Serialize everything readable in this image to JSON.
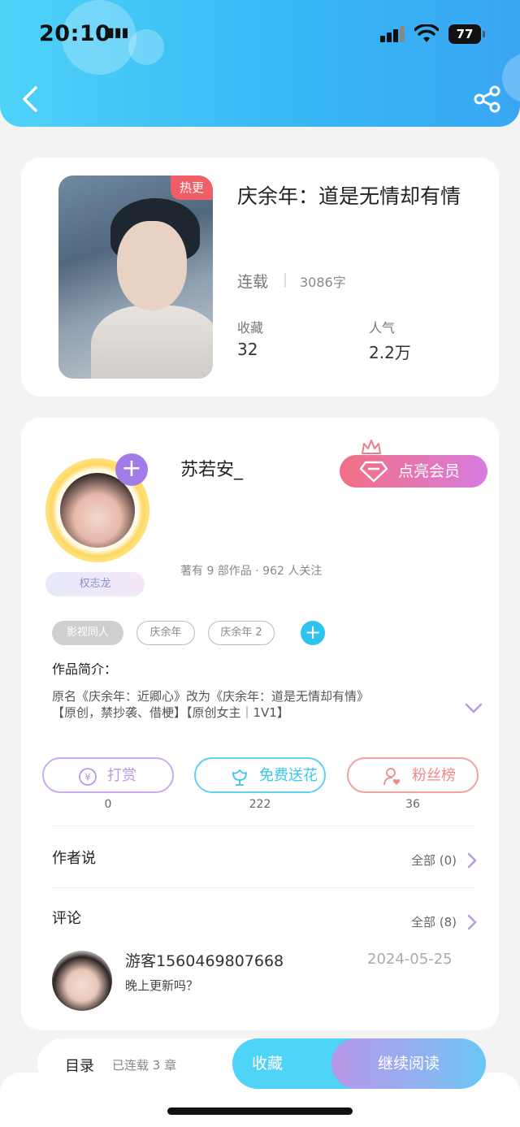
{
  "status_bar": {
    "time": "20:10",
    "battery": "77"
  },
  "header": {
    "back_icon": "chevron-left-icon",
    "share_icon": "share-icon"
  },
  "book": {
    "badge": "热更",
    "title": "庆余年：道是无情却有情",
    "status": "连载",
    "word_count": "3086字",
    "favorites_label": "收藏",
    "favorites_value": "32",
    "popularity_label": "人气",
    "popularity_value": "2.2万"
  },
  "author": {
    "name": "苏若安_",
    "vip_button": "点亮会员",
    "meta": "著有 9 部作品 · 962 人关注",
    "badge": "权志龙",
    "tags": [
      "影视同人",
      "庆余年",
      "庆余年 2"
    ],
    "intro_title": "作品简介：",
    "intro_lines": [
      "原名《庆余年：近卿心》改为《庆余年：道是无情却有情》",
      "【原创，禁抄袭、借梗】【原创女主｜1V1】"
    ]
  },
  "actions": [
    {
      "label": "打赏",
      "count": "0",
      "color": "#b89ae6"
    },
    {
      "label": "免费送花",
      "count": "222",
      "color": "#39c6ea"
    },
    {
      "label": "粉丝榜",
      "count": "36",
      "color": "#f08a8a"
    }
  ],
  "author_says": {
    "title": "作者说",
    "more": "全部 (0)"
  },
  "comments": {
    "title": "评论",
    "more": "全部 (8)",
    "items": [
      {
        "user": "游客1560469807668",
        "date": "2024-05-25",
        "text": "晚上更新吗？"
      }
    ]
  },
  "bottom_bar": {
    "toc": "目录",
    "toc_count": "已连载 3 章",
    "favorite": "收藏",
    "continue": "继续阅读"
  }
}
